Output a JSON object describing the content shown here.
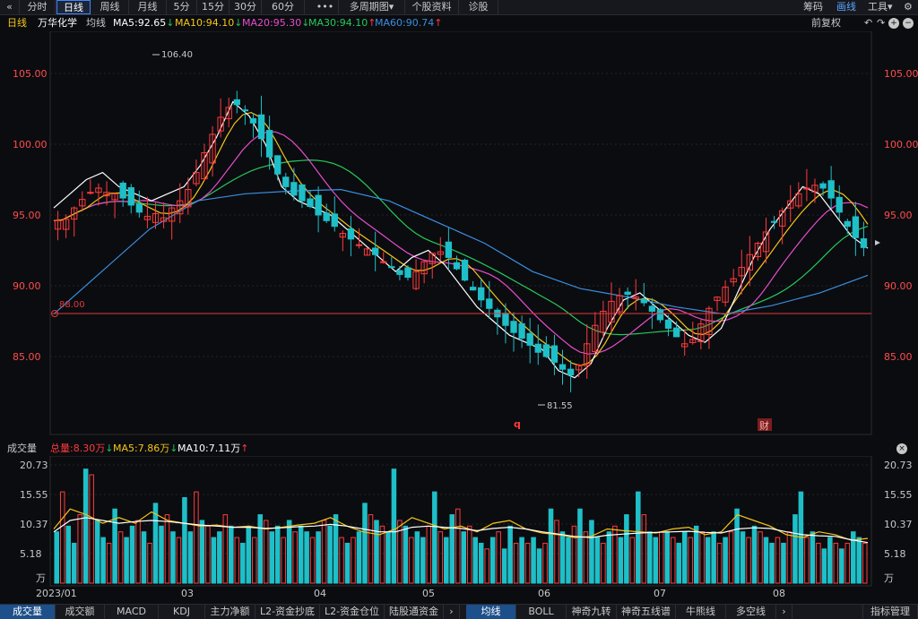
{
  "toolbar": {
    "collapse_icon": "double-chevron-left-icon",
    "collapse_glyph": "«",
    "periods": [
      "分时",
      "日线",
      "周线",
      "月线",
      "5分",
      "15分",
      "30分",
      "60分"
    ],
    "active_period": "日线",
    "more_glyph": "•••",
    "multi_period": "多周期图",
    "multi_period_caret": "▾",
    "stock_info": "个股资料",
    "diagnose": "诊股",
    "chips": "筹码",
    "draw_line": "画线",
    "tools": "工具",
    "tools_caret": "▾",
    "settings_glyph": "⚙"
  },
  "info_bar": {
    "period": "日线",
    "stock_name": "万华化学",
    "ma_label": "均线",
    "ma5": "MA5:92.65",
    "ma10": "MA10:94.10",
    "ma20": "MA20:95.30",
    "ma30": "MA30:94.10",
    "ma60": "MA60:90.74",
    "adjust": "前复权",
    "arrow_down": "↓",
    "arrow_up": "↑",
    "undo_glyph": "↶",
    "redo_glyph": "↷",
    "zoom_in_glyph": "+",
    "zoom_out_glyph": "−"
  },
  "colors": {
    "ma5": "#ffffff",
    "ma10": "#f5c518",
    "ma20": "#e64dcb",
    "ma30": "#28c85a",
    "ma60": "#3a8fe0",
    "up": "#ff3b3b",
    "down": "#1fbfc8",
    "price_axis": "#ff4d4d",
    "grid": "#2a2222",
    "ref_line": "#e0383a"
  },
  "main_chart": {
    "y_ticks": [
      "105.00",
      "100.00",
      "95.00",
      "90.00",
      "85.00"
    ],
    "high_label": "106.40",
    "low_label": "81.55",
    "ref_label": "88.00",
    "marker_q": "q",
    "marker_cai": "财"
  },
  "volume": {
    "title": "成交量",
    "total": "总量:8.30万",
    "ma5": "MA5:7.86万",
    "ma10": "MA10:7.11万",
    "y_ticks": [
      "20.73",
      "15.55",
      "10.37",
      "5.18"
    ],
    "unit": "万",
    "close_glyph": "×"
  },
  "x_axis": [
    "2023/01",
    "03",
    "04",
    "05",
    "06",
    "07",
    "08"
  ],
  "bottom_tabs_left": [
    "成交量",
    "成交额",
    "MACD",
    "KDJ",
    "主力净额",
    "L2-资金抄底",
    "L2-资金仓位",
    "陆股通资金"
  ],
  "bottom_tabs_right": [
    "均线",
    "BOLL",
    "神奇九转",
    "神奇五线谱",
    "牛熊线",
    "多空线"
  ],
  "tabs_arrow": "›",
  "indicator_manage": "指标管理",
  "chart_data": {
    "type": "candlestick",
    "price_range": [
      81.55,
      106.4
    ],
    "ylim": [
      81,
      108
    ],
    "candles_close": [
      94.6,
      94.7,
      95.5,
      96.1,
      96.6,
      96.9,
      96.6,
      96.5,
      96.2,
      95.7,
      95.2,
      94.9,
      95.1,
      94.8,
      95.5,
      96.0,
      96.8,
      98.0,
      99.4,
      100.7,
      101.9,
      102.6,
      102.8,
      102.4,
      101.5,
      100.4,
      99.1,
      97.9,
      97.0,
      96.4,
      96.0,
      95.6,
      95.0,
      94.6,
      94.2,
      93.7,
      93.3,
      92.9,
      92.6,
      92.2,
      91.7,
      91.3,
      90.8,
      90.6,
      91.0,
      91.7,
      92.3,
      92.4,
      92.0,
      91.2,
      90.4,
      89.7,
      89.0,
      88.4,
      87.8,
      87.2,
      86.7,
      86.3,
      85.8,
      85.3,
      85.0,
      84.6,
      84.1,
      83.7,
      84.4,
      85.9,
      87.2,
      88.2,
      88.9,
      89.3,
      89.4,
      89.2,
      88.8,
      88.2,
      87.6,
      87.0,
      86.4,
      85.9,
      86.2,
      87.3,
      88.4,
      89.2,
      89.9,
      90.5,
      91.3,
      92.2,
      93.0,
      93.8,
      94.5,
      95.3,
      96.0,
      96.5,
      96.9,
      97.1,
      96.9,
      96.2,
      95.2,
      94.2,
      93.4,
      92.7
    ],
    "ma5": [
      95.5,
      96.5,
      97.5,
      98.0,
      97.0,
      96.5,
      96.0,
      96.5,
      97.0,
      98.5,
      100.5,
      103.0,
      102.0,
      100.0,
      97.0,
      96.0,
      95.5,
      95.0,
      94.0,
      93.0,
      92.0,
      91.0,
      92.0,
      92.5,
      91.5,
      90.0,
      88.5,
      87.5,
      86.5,
      86.0,
      85.5,
      84.0,
      83.5,
      84.5,
      87.0,
      89.0,
      89.5,
      88.5,
      87.5,
      86.5,
      86.0,
      87.0,
      89.5,
      92.0,
      94.0,
      95.5,
      97.0,
      96.5,
      95.0,
      93.5,
      92.65
    ],
    "ma60": [
      88.0,
      91.0,
      94.0,
      96.0,
      96.5,
      96.7,
      96.8,
      96.0,
      94.5,
      93.0,
      91.0,
      89.8,
      89.2,
      88.5,
      88.0,
      88.6,
      89.5,
      90.74
    ],
    "series": [
      {
        "name": "MA5",
        "last": 92.65
      },
      {
        "name": "MA10",
        "last": 94.1
      },
      {
        "name": "MA20",
        "last": 95.3
      },
      {
        "name": "MA30",
        "last": 94.1
      },
      {
        "name": "MA60",
        "last": 90.74
      }
    ],
    "volume_ylim": [
      0,
      20.73
    ],
    "volume_values": [
      9,
      16,
      10,
      7,
      12,
      20,
      19,
      11,
      8,
      7,
      13,
      9,
      8,
      10,
      11,
      9,
      7,
      14,
      10,
      12,
      9,
      8,
      15,
      9,
      16,
      11,
      10,
      8,
      9,
      12,
      10,
      8,
      7,
      10,
      8,
      12,
      11,
      9,
      10,
      8,
      11,
      9,
      10,
      9,
      8,
      9,
      11,
      10,
      12,
      8,
      7,
      8,
      9,
      14,
      12,
      11,
      10,
      9,
      20,
      11,
      10,
      8,
      9,
      8,
      10,
      16,
      9,
      8,
      12,
      13,
      9,
      10,
      8,
      7,
      6,
      8,
      9,
      6,
      10,
      7,
      8,
      7,
      8,
      6,
      7,
      13,
      11,
      9,
      8,
      10,
      13,
      9,
      11,
      8,
      7,
      9,
      10,
      8,
      12,
      8,
      16,
      12,
      9,
      8,
      9,
      9,
      8,
      7,
      9,
      8,
      10,
      9,
      8,
      9,
      7,
      8,
      9,
      13,
      9,
      8,
      10,
      9,
      8,
      7,
      8,
      7,
      9,
      12,
      16,
      8,
      9,
      7,
      6,
      8,
      7,
      6,
      7,
      9,
      8,
      7
    ],
    "volume_ma5": [
      9.5,
      13.0,
      12.0,
      10.5,
      11.5,
      10.5,
      12.5,
      11.0,
      10.5,
      10.0,
      10.2,
      9.8,
      10.0,
      9.5,
      9.8,
      10.2,
      10.5,
      11.5,
      10.0,
      9.0,
      8.5,
      9.5,
      11.5,
      10.5,
      9.5,
      10.0,
      9.0,
      10.5,
      11.0,
      9.5,
      8.8,
      8.5,
      8.0,
      8.2,
      9.5,
      9.2,
      9.0,
      8.8,
      9.5,
      9.8,
      8.5,
      9.0,
      12.0,
      11.0,
      10.0,
      8.5,
      8.0,
      9.0,
      8.5,
      7.5,
      7.86
    ],
    "volume_ma10": [
      9.0,
      11.0,
      11.5,
      11.0,
      10.5,
      10.8,
      11.0,
      10.8,
      10.5,
      10.2,
      10.0,
      9.8,
      9.8,
      9.6,
      9.7,
      9.9,
      10.0,
      10.3,
      10.0,
      9.5,
      9.0,
      9.0,
      9.8,
      10.0,
      9.8,
      9.6,
      9.2,
      9.6,
      9.8,
      9.5,
      9.0,
      8.6,
      8.2,
      8.0,
      8.4,
      8.6,
      8.8,
      8.9,
      9.0,
      9.1,
      8.9,
      8.8,
      9.5,
      9.7,
      9.6,
      9.0,
      8.5,
      8.3,
      8.2,
      7.6,
      7.11
    ]
  }
}
